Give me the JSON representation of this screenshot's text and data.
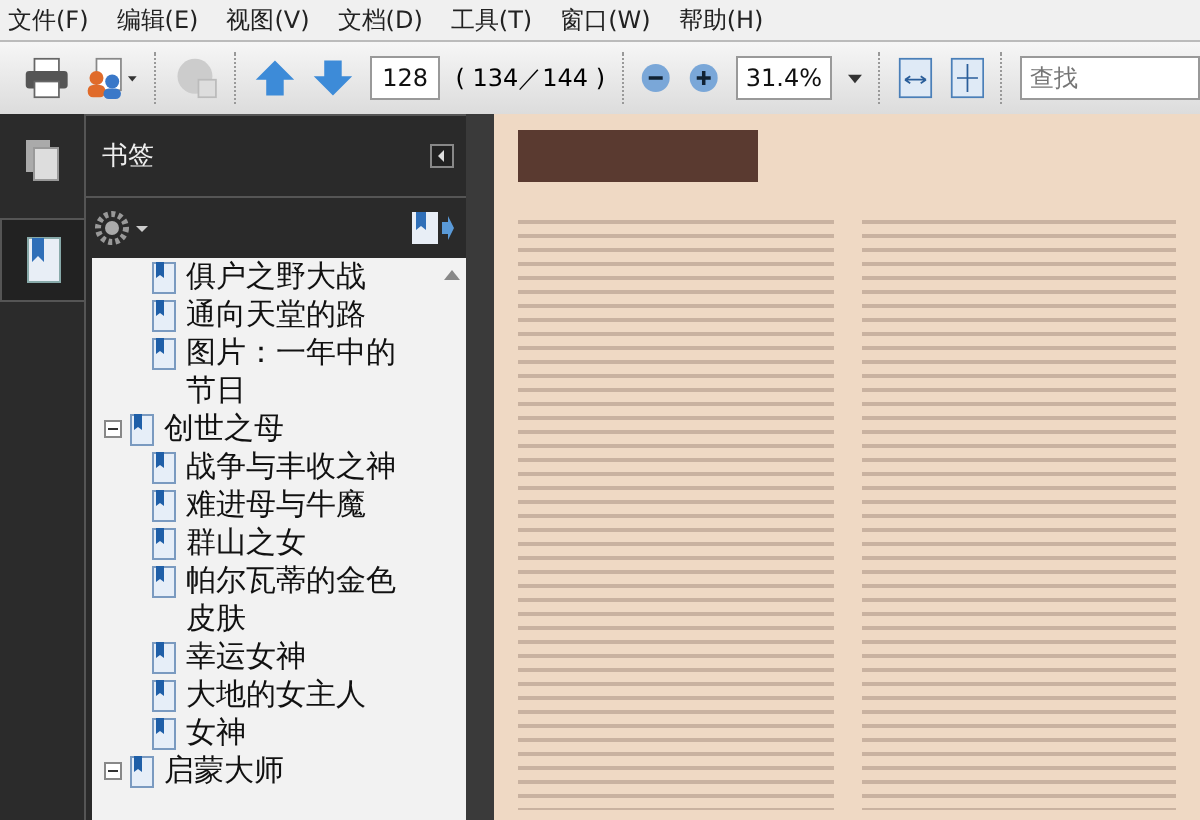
{
  "menu": [
    "文件(F)",
    "编辑(E)",
    "视图(V)",
    "文档(D)",
    "工具(T)",
    "窗口(W)",
    "帮助(H)"
  ],
  "toolbar": {
    "page_number": "128",
    "page_count": "( 134／144 )",
    "zoom": "31.4%",
    "search": {
      "placeholder": "查找"
    }
  },
  "bookmarks_panel": {
    "title": "书签",
    "items": [
      {
        "children": [
          {
            "label": "俱户之野大战"
          },
          {
            "label": "通向天堂的路"
          },
          {
            "label": "图片：一年中的节日"
          }
        ]
      },
      {
        "label": "创世之母",
        "expanded": true,
        "children": [
          {
            "label": "战争与丰收之神"
          },
          {
            "label": "难进母与牛魔"
          },
          {
            "label": "群山之女"
          },
          {
            "label": "帕尔瓦蒂的金色皮肤"
          },
          {
            "label": "幸运女神"
          },
          {
            "label": "大地的女主人"
          },
          {
            "label": "女神"
          }
        ]
      },
      {
        "label": "启蒙大师",
        "expanded": true
      }
    ]
  }
}
